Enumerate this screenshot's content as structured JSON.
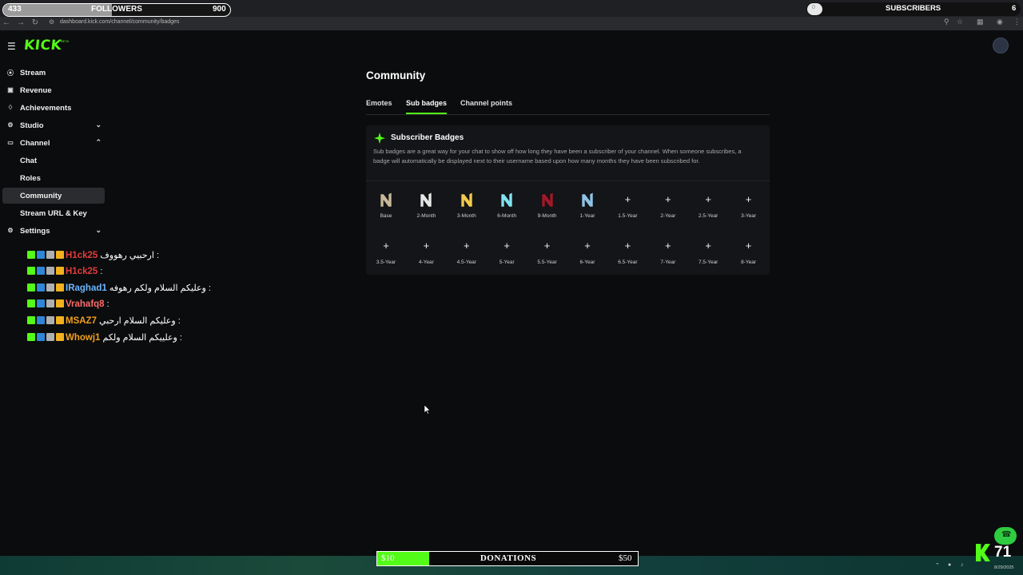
{
  "overlay": {
    "followers": {
      "current": "433",
      "label": "FOLLOWERS",
      "goal": "900",
      "progress": 0.48
    },
    "subscribers": {
      "label": "SUBSCRIBERS",
      "goal": "6",
      "progress": 0.0
    }
  },
  "browser": {
    "url": "dashboard.kick.com/channel/community/badges"
  },
  "sidebar": {
    "logo": "KICK",
    "logo_tag": "BETA",
    "items": [
      {
        "label": "Stream",
        "icon": "broadcast-icon"
      },
      {
        "label": "Revenue",
        "icon": "wallet-icon"
      },
      {
        "label": "Achievements",
        "icon": "trophy-icon"
      },
      {
        "label": "Studio",
        "icon": "studio-icon",
        "chevron": "down"
      },
      {
        "label": "Channel",
        "icon": "channel-icon",
        "chevron": "up"
      },
      {
        "label": "Chat"
      },
      {
        "label": "Roles"
      },
      {
        "label": "Community",
        "active": true
      },
      {
        "label": "Stream URL & Key"
      },
      {
        "label": "Settings",
        "icon": "gear-icon",
        "chevron": "down"
      }
    ]
  },
  "chat_overlay": [
    {
      "user": "H1ck25",
      "color": "#e33b3b",
      "message": "ارحبيي رهووف :"
    },
    {
      "user": "H1ck25",
      "color": "#e33b3b",
      "message": ":"
    },
    {
      "user": "IRaghad1",
      "color": "#6bb6ff",
      "message": "وعليكم السلام ولكم رهوفه :"
    },
    {
      "user": "Vrahafq8",
      "color": "#ff6b6b",
      "message": ":"
    },
    {
      "user": "MSAZ7",
      "color": "#f0a01e",
      "message": "وعليكم السلام ارحبي :"
    },
    {
      "user": "Whowj1",
      "color": "#f0a01e",
      "message": "وعلييكم السلام ولكم :"
    }
  ],
  "main": {
    "title": "Community",
    "tabs": [
      "Emotes",
      "Sub badges",
      "Channel points"
    ],
    "active_tab": "Sub badges",
    "panel": {
      "title": "Subscriber Badges",
      "description": "Sub badges are a great way for your chat to show off how long they have been a subscriber of your channel. When someone subscribes, a badge will automatically be displayed next to their username based upon how many months they have been subscribed for.",
      "badges": [
        {
          "label": "Base",
          "set": true,
          "color": "#c8b89a"
        },
        {
          "label": "2-Month",
          "set": true,
          "color": "#e6e6e6"
        },
        {
          "label": "3-Month",
          "set": true,
          "color": "#f2c94c"
        },
        {
          "label": "6-Month",
          "set": true,
          "color": "#7fe3f2"
        },
        {
          "label": "9-Month",
          "set": true,
          "color": "#a0182a"
        },
        {
          "label": "1-Year",
          "set": true,
          "color": "#8fc3e6"
        },
        {
          "label": "1.5-Year",
          "set": false
        },
        {
          "label": "2-Year",
          "set": false
        },
        {
          "label": "2.5-Year",
          "set": false
        },
        {
          "label": "3-Year",
          "set": false
        },
        {
          "label": "3.5-Year",
          "set": false
        },
        {
          "label": "4-Year",
          "set": false
        },
        {
          "label": "4.5-Year",
          "set": false
        },
        {
          "label": "5-Year",
          "set": false
        },
        {
          "label": "5.5-Year",
          "set": false
        },
        {
          "label": "6-Year",
          "set": false
        },
        {
          "label": "6.5-Year",
          "set": false
        },
        {
          "label": "7-Year",
          "set": false
        },
        {
          "label": "7.5-Year",
          "set": false
        },
        {
          "label": "8-Year",
          "set": false
        }
      ]
    }
  },
  "donations": {
    "title": "DONATIONS",
    "current": "$10",
    "goal": "$50",
    "progress": 0.2
  },
  "kick_counter": {
    "value": "71"
  },
  "system": {
    "date": "8/29/2025"
  },
  "colors": {
    "accent": "#53fc18",
    "bg": "#0b0c0d",
    "panel": "#141518"
  }
}
